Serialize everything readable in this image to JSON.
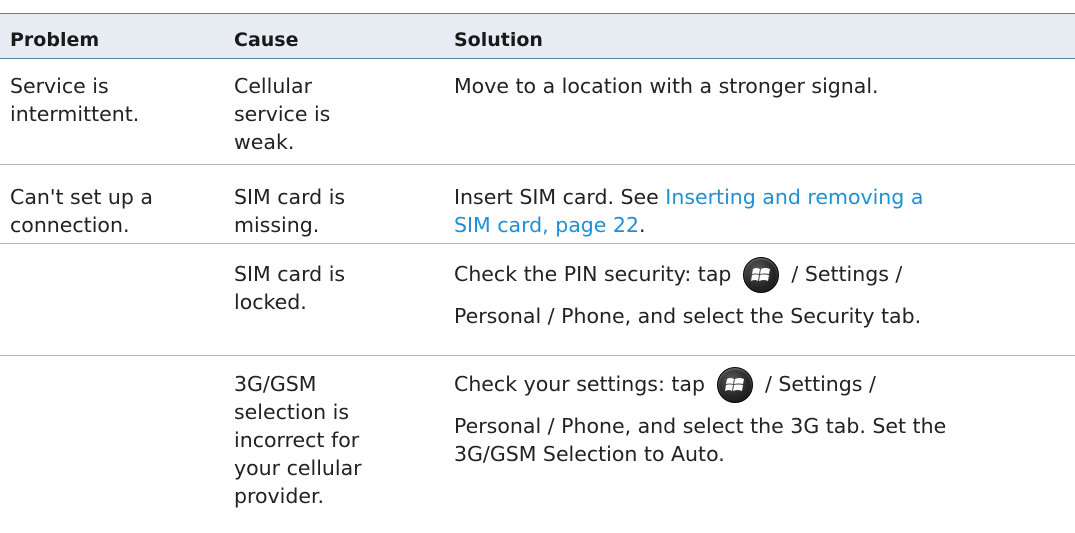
{
  "headers": {
    "problem": "Problem",
    "cause": "Cause",
    "solution": "Solution"
  },
  "rows": [
    {
      "problem": [
        "Service is",
        "intermittent."
      ],
      "cause": [
        "Cellular",
        "service is",
        "weak."
      ],
      "solution": [
        "Move to a location with a stronger signal."
      ]
    },
    {
      "problem": [
        "Can't set up a",
        "connection."
      ],
      "cause": [
        "SIM card is",
        "missing."
      ],
      "solution_prefix": "Insert SIM card. See ",
      "solution_link_line1": "Inserting and removing a",
      "solution_link_line2": "SIM card, page 22",
      "solution_suffix": "."
    },
    {
      "problem": [],
      "cause": [
        "SIM card is",
        "locked."
      ],
      "solution_line1_before": "Check the PIN security: tap",
      "solution_line1_after": "/ Settings /",
      "solution_line2": "Personal / Phone, and select the Security tab."
    },
    {
      "problem": [],
      "cause": [
        "3G/GSM",
        "selection is",
        "incorrect for",
        "your cellular",
        "provider."
      ],
      "solution_line1_before": "Check your settings: tap",
      "solution_line1_after": "/ Settings /",
      "solution_line2": "Personal / Phone, and select the 3G tab. Set the",
      "solution_line3": "3G/GSM Selection to Auto."
    }
  ],
  "icons": {
    "start_button": "windows-start-icon"
  },
  "colors": {
    "header_bg": "#e8edf4",
    "rule": "#5b7fa6",
    "link": "#1f8fd6"
  }
}
